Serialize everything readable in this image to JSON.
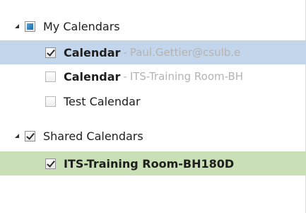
{
  "my_calendars": {
    "label": "My Calendars",
    "items": [
      {
        "name": "Calendar",
        "sep": "-",
        "subtitle": "Paul.Gettier@csulb.e",
        "checked": true
      },
      {
        "name": "Calendar",
        "sep": "-",
        "subtitle": "ITS-Training Room-BH",
        "checked": false
      },
      {
        "name": "Test Calendar",
        "checked": false
      }
    ]
  },
  "shared_calendars": {
    "label": "Shared Calendars",
    "items": [
      {
        "name": "ITS-Training Room-BH180D",
        "checked": true
      }
    ]
  },
  "colors": {
    "selected_blue": "#c3d5ea",
    "selected_green": "#c9dfb5"
  }
}
